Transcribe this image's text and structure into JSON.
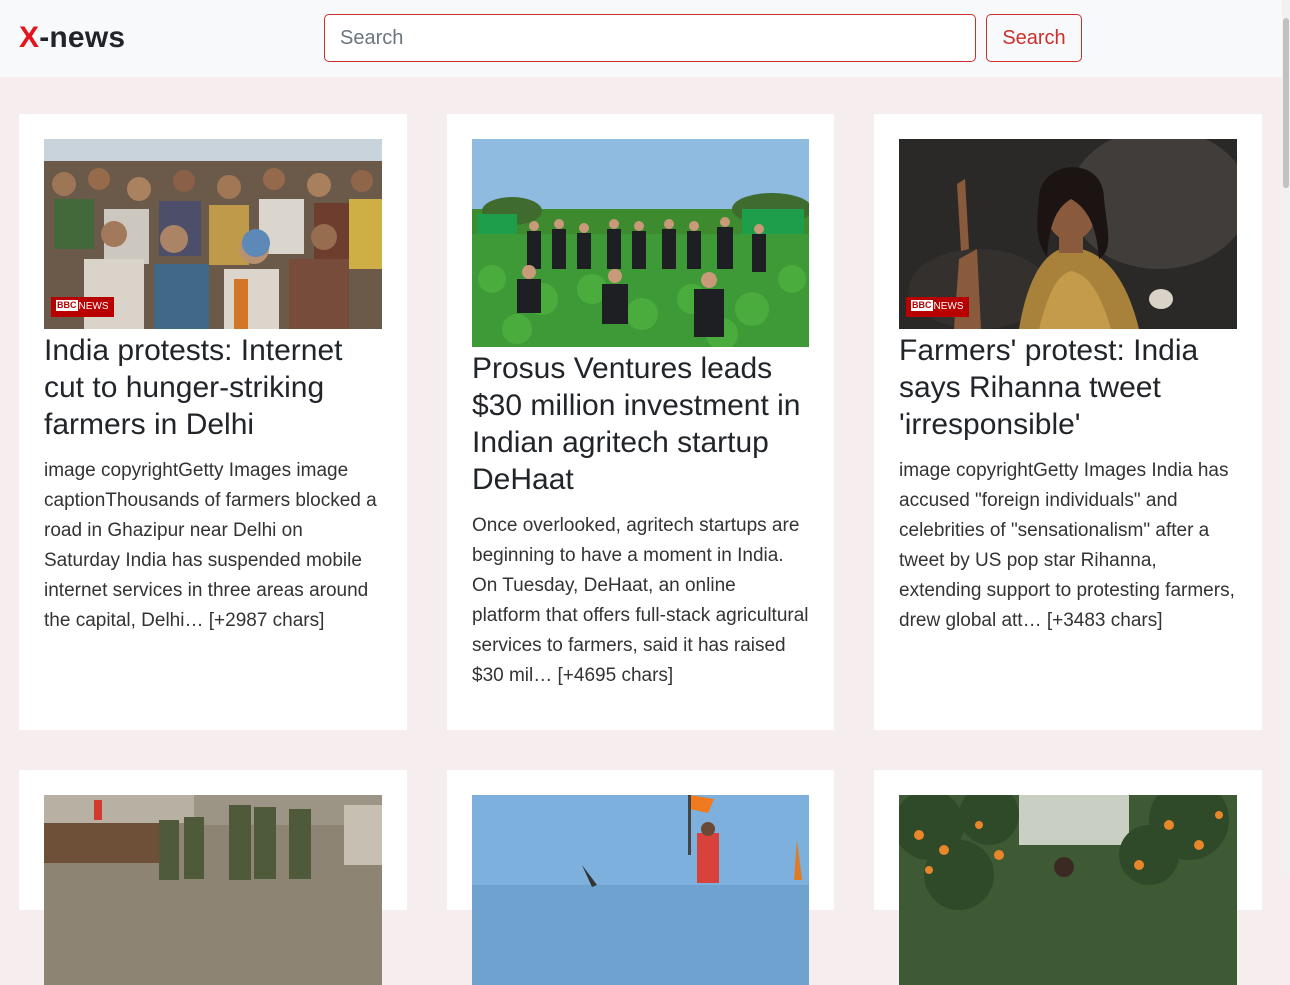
{
  "navbar": {
    "brand_accent": "X",
    "brand_rest": "-news",
    "search_placeholder": "Search",
    "search_button": "Search"
  },
  "colors": {
    "brand_red": "#e5141e",
    "button_red": "#c9302c",
    "page_bg": "#f6eeee",
    "navbar_bg": "#f8f9fa"
  },
  "articles": [
    {
      "title": "India protests: Internet cut to hunger-striking farmers in Delhi",
      "description": "image copyrightGetty Images image captionThousands of farmers blocked a road in Ghazipur near Delhi on Saturday India has suspended mobile internet services in three areas around the capital, Delhi… [+2987 chars]",
      "image": "crowd-of-protesting-farmers-photo",
      "badge": {
        "logo": "BBC",
        "label": "NEWS"
      }
    },
    {
      "title": "Prosus Ventures leads $30 million investment in Indian agritech startup DeHaat",
      "description": "Once overlooked, agritech startups are beginning to have a moment in India. On Tuesday, DeHaat, an online platform that offers full-stack agricultural services to farmers, said it has raised $30 mil… [+4695 chars]",
      "image": "team-standing-in-crop-field-photo"
    },
    {
      "title": "Farmers' protest: India says Rihanna tweet 'irresponsible'",
      "description": "image copyrightGetty Images India has accused \"foreign individuals\" and celebrities of \"sensationalism\" after a tweet by US pop star Rihanna, extending support to protesting farmers, drew global att… [+3483 chars]",
      "image": "singer-on-stage-photo",
      "badge": {
        "logo": "BBC",
        "label": "NEWS"
      }
    },
    {
      "title": "",
      "description": "",
      "image": "security-forces-at-barricade-photo"
    },
    {
      "title": "",
      "description": "",
      "image": "protester-with-flag-photo"
    },
    {
      "title": "",
      "description": "",
      "image": "orange-orchard-photo"
    }
  ]
}
